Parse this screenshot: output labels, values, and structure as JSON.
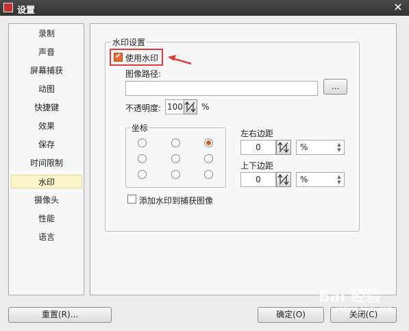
{
  "window": {
    "title": "设置"
  },
  "sidebar": {
    "items": [
      {
        "label": "录制"
      },
      {
        "label": "声音"
      },
      {
        "label": "屏幕捕获"
      },
      {
        "label": "动图"
      },
      {
        "label": "快捷键"
      },
      {
        "label": "效果"
      },
      {
        "label": "保存"
      },
      {
        "label": "时间限制"
      },
      {
        "label": "水印"
      },
      {
        "label": "摄像头"
      },
      {
        "label": "性能"
      },
      {
        "label": "语言"
      }
    ],
    "active_index": 8
  },
  "watermark_settings": {
    "group_title": "水印设置",
    "use_watermark_label": "使用水印",
    "use_watermark_checked": true,
    "image_path_label": "图像路径:",
    "image_path_value": "",
    "browse_label": "...",
    "opacity_label": "不透明度:",
    "opacity_value": "100",
    "opacity_unit": "%",
    "coordinates_title": "坐标",
    "selected_position": "top-right",
    "horizontal_margin_label": "左右边距",
    "horizontal_margin_value": "0",
    "horizontal_unit": "%",
    "vertical_margin_label": "上下边距",
    "vertical_margin_value": "0",
    "vertical_unit": "%",
    "add_to_capture_label": "添加水印到捕获图像",
    "add_to_capture_checked": false
  },
  "footer": {
    "reset_label": "重置(R)...",
    "ok_label": "确定(O)",
    "close_label": "关闭(C)"
  },
  "overlay": {
    "watermark_text": "Bai 经验",
    "watermark_sub": "jingyan.baidu.com"
  },
  "colors": {
    "accent": "#e86b2b",
    "annotation": "#e03a3a",
    "active_item_bg": "#fbf3c9"
  }
}
